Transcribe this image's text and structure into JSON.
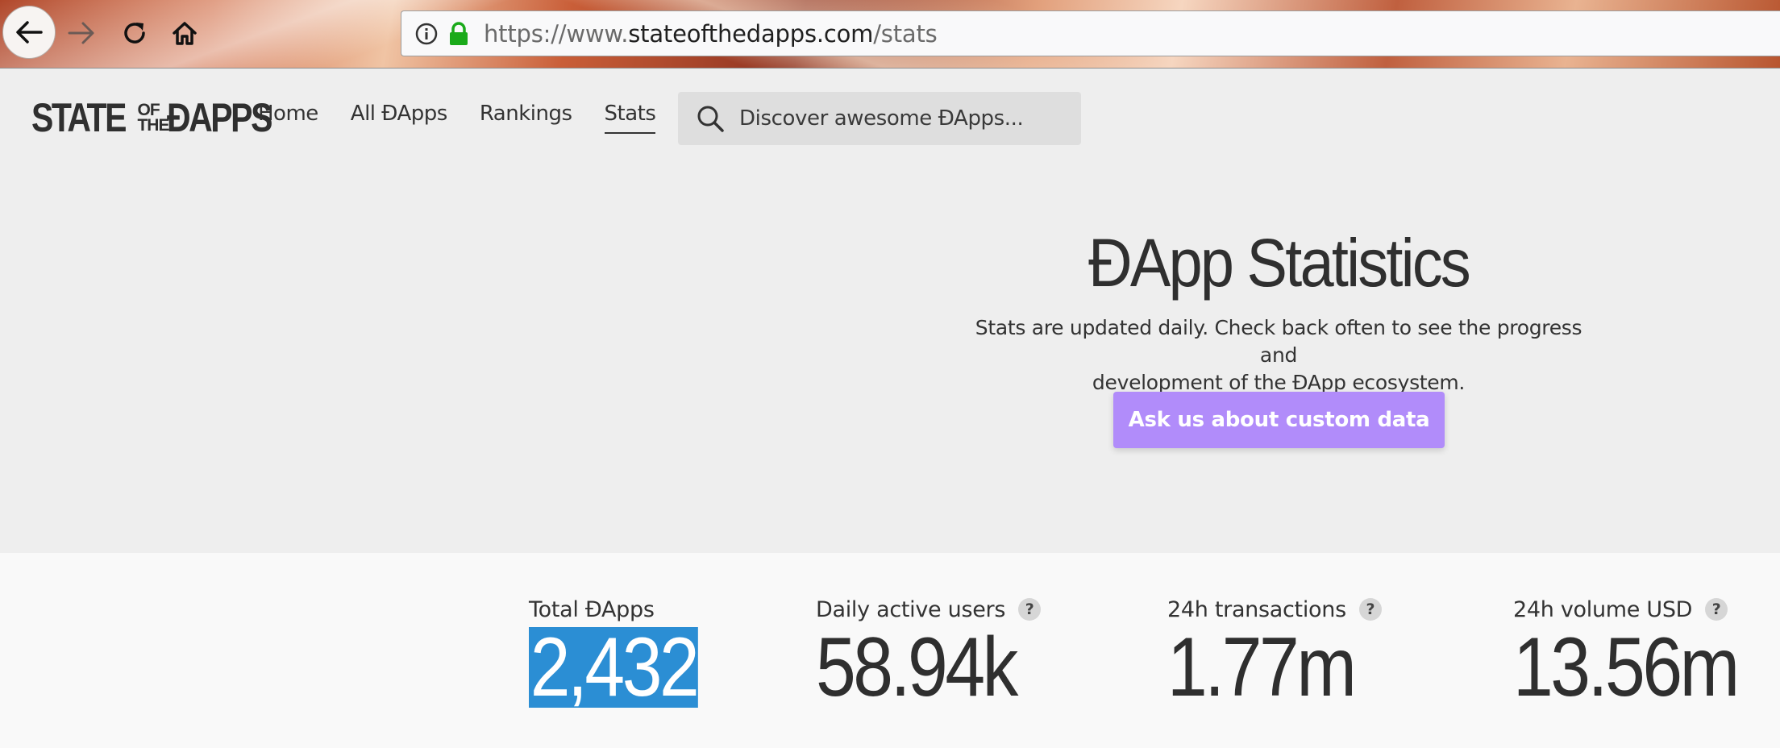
{
  "browser": {
    "url_prefix": "https://www.",
    "url_domain": "stateofthedapps.com",
    "url_path": "/stats"
  },
  "site": {
    "logo": {
      "part1": "STATE",
      "small_top": "OF",
      "small_bottom": "THE",
      "part2": "ÐAPPS"
    },
    "nav": [
      {
        "label": "Home"
      },
      {
        "label": "All ÐApps"
      },
      {
        "label": "Rankings"
      },
      {
        "label": "Stats",
        "active": true
      }
    ],
    "search_placeholder": "Discover awesome ÐApps..."
  },
  "hero": {
    "title": "ÐApp Statistics",
    "subtitle_line1": "Stats are updated daily. Check back often to see the progress and",
    "subtitle_line2": "development of the ÐApp ecosystem.",
    "cta_label": "Ask us about custom data",
    "cta_color": "#b18cfa"
  },
  "stats": [
    {
      "label": "Total ÐApps",
      "value": "2,432",
      "help": false
    },
    {
      "label": "Daily active users",
      "value": "58.94k",
      "help": true
    },
    {
      "label": "24h transactions",
      "value": "1.77m",
      "help": true
    },
    {
      "label": "24h volume USD",
      "value": "13.56m",
      "help": true
    }
  ],
  "help_glyph": "?"
}
